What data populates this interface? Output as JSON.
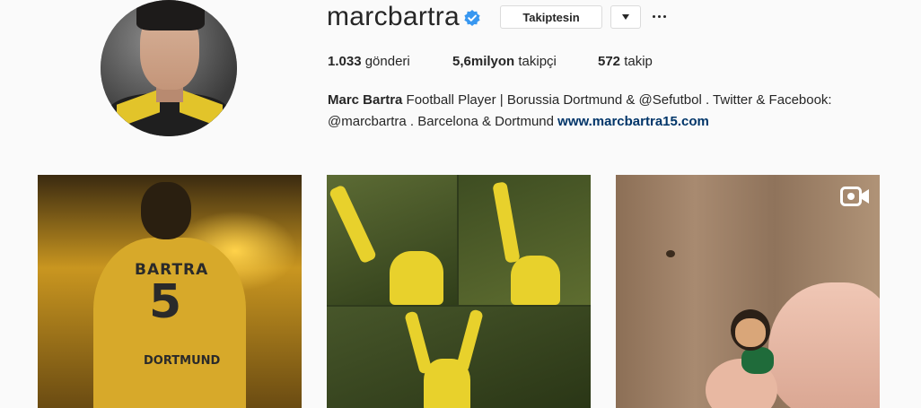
{
  "profile": {
    "username": "marcbartra",
    "verified": true,
    "follow_button": "Takiptesin",
    "dropdown_icon": "caret-down-icon",
    "more_icon": "ellipsis-icon",
    "stats": {
      "posts_count": "1.033",
      "posts_label": "gönderi",
      "followers_count": "5,6milyon",
      "followers_label": "takipçi",
      "following_count": "572",
      "following_label": "takip"
    },
    "bio": {
      "full_name": "Marc Bartra",
      "text_line1": " Football Player | Borussia Dortmund & @Sefutbol . Twitter & Facebook:",
      "text_line2": "@marcbartra . Barcelona & Dortmund ",
      "website": "www.marcbartra15.com"
    }
  },
  "posts": [
    {
      "kind": "photo",
      "jersey_name": "BARTRA",
      "jersey_number": "5",
      "jersey_club": "DORTMUND"
    },
    {
      "kind": "photo-collage"
    },
    {
      "kind": "video",
      "icon": "video-camera-icon"
    }
  ],
  "colors": {
    "background": "#fafafa",
    "text": "#262626",
    "link": "#003569",
    "verified_badge": "#3897f0",
    "border": "#dbdbdb"
  }
}
